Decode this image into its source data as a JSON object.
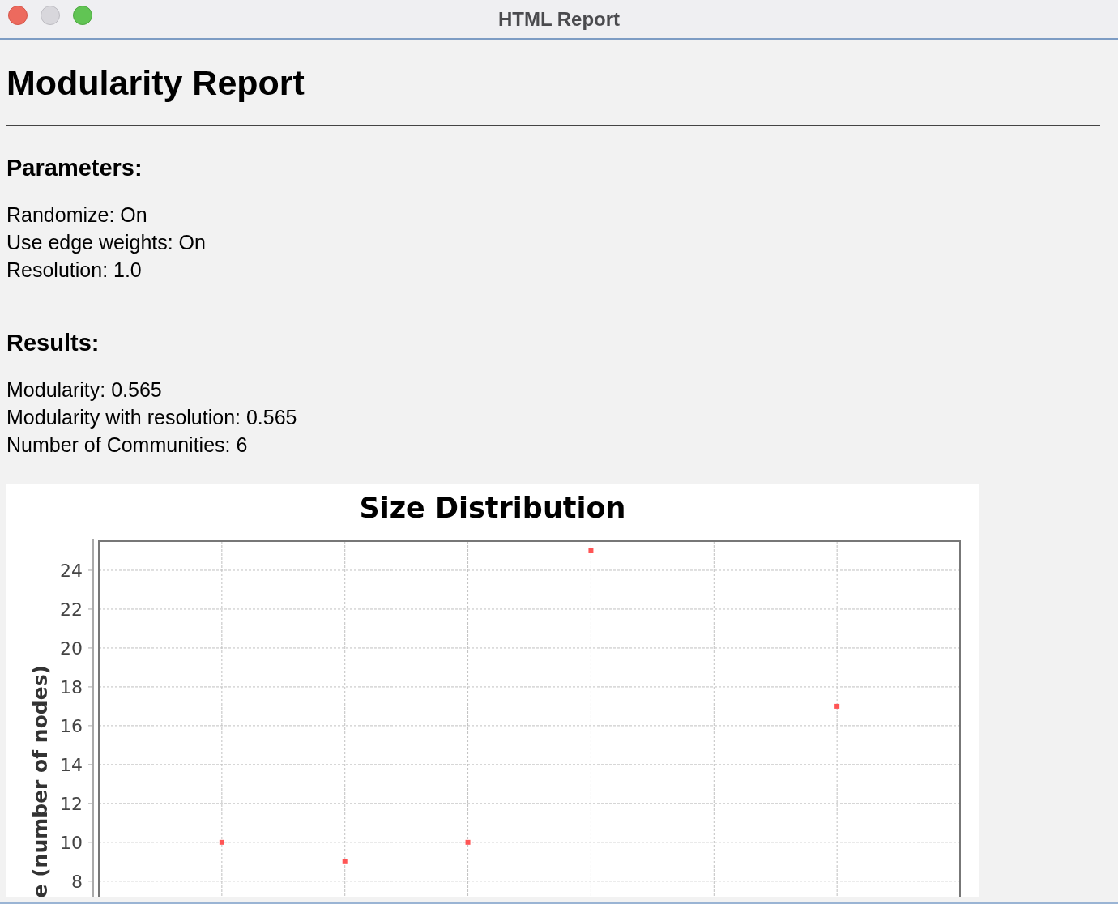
{
  "window": {
    "title": "HTML Report"
  },
  "report": {
    "title": "Modularity Report",
    "sections": [
      {
        "heading": "Parameters:",
        "lines": [
          "Randomize: On",
          "Use edge weights: On",
          "Resolution: 1.0"
        ]
      },
      {
        "heading": "Results:",
        "lines": [
          "Modularity: 0.565",
          "Modularity with resolution: 0.565",
          "Number of Communities: 6"
        ]
      }
    ],
    "chart_data": {
      "type": "scatter",
      "title": "Size Distribution",
      "ylabel": "e (number of nodes)",
      "categories": [
        null,
        null,
        null,
        null,
        null,
        null
      ],
      "series": [
        {
          "color": "#ff5555",
          "values": [
            10,
            9,
            10,
            25,
            null,
            17
          ]
        }
      ],
      "ylim": [
        7.2,
        25.5
      ],
      "grid": true,
      "yticks": [
        8,
        10,
        12,
        14,
        16,
        18,
        20,
        22,
        24
      ]
    }
  }
}
